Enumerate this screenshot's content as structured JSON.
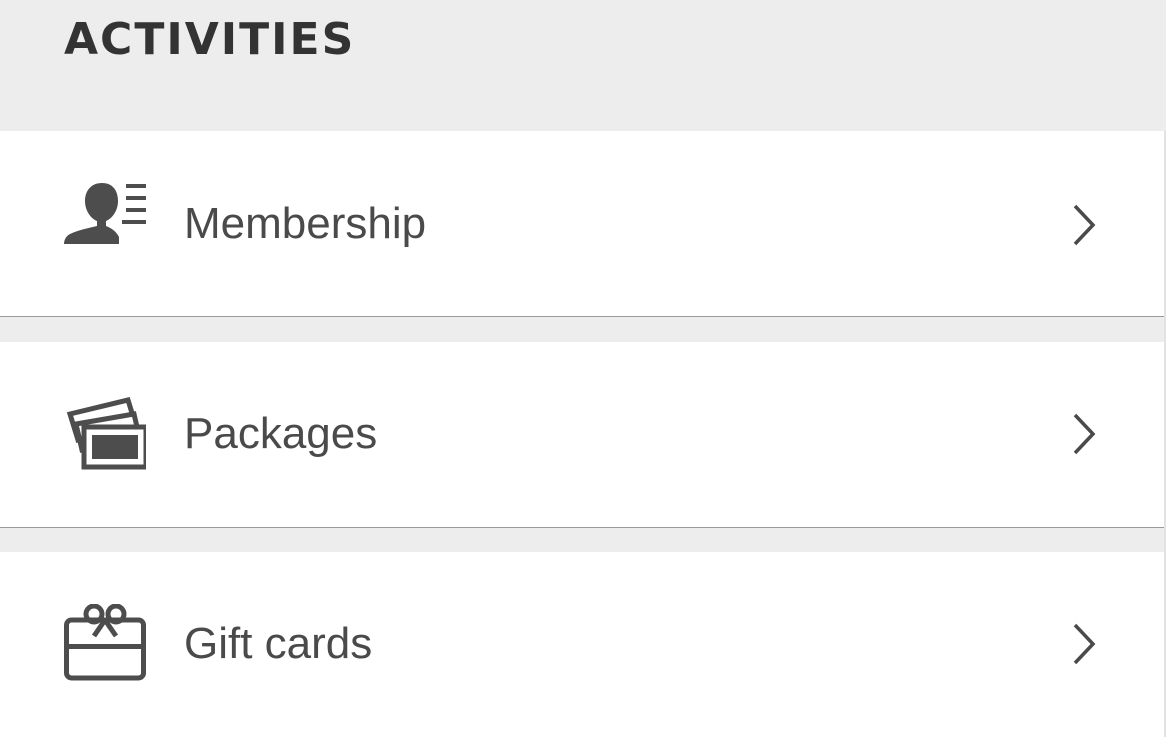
{
  "header": {
    "title": "ACTIVITIES"
  },
  "items": [
    {
      "label": "Membership",
      "icon": "membership-icon"
    },
    {
      "label": "Packages",
      "icon": "packages-icon"
    },
    {
      "label": "Gift cards",
      "icon": "gift-card-icon"
    }
  ],
  "colors": {
    "background": "#ededed",
    "row_background": "#ffffff",
    "text": "#4a4a4a",
    "title": "#333333",
    "icon": "#4d4d4d",
    "divider": "#9a9a9a"
  }
}
